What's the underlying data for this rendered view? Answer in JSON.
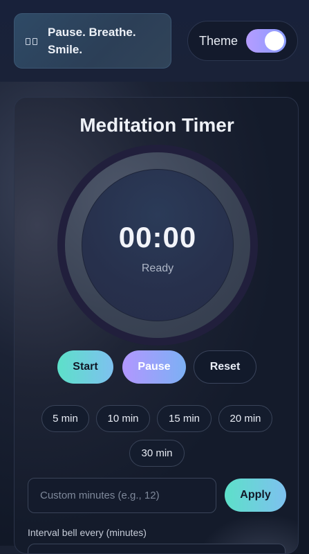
{
  "header": {
    "quote": "Pause. Breathe. Smile.",
    "quote_icon": "quote-icon",
    "theme_label": "Theme",
    "theme_toggle_on": true
  },
  "timer": {
    "title": "Meditation Timer",
    "time": "00:00",
    "status": "Ready"
  },
  "controls": {
    "start_label": "Start",
    "pause_label": "Pause",
    "reset_label": "Reset"
  },
  "presets": [
    "5 min",
    "10 min",
    "15 min",
    "20 min",
    "30 min"
  ],
  "custom": {
    "placeholder": "Custom minutes (e.g., 12)",
    "value": "",
    "apply_label": "Apply"
  },
  "interval": {
    "label": "Interval bell every (minutes)"
  },
  "colors": {
    "accent_teal": "#5de0c9",
    "accent_purple": "#b297ff",
    "accent_blue": "#7ec1ef",
    "background": "#111827"
  }
}
